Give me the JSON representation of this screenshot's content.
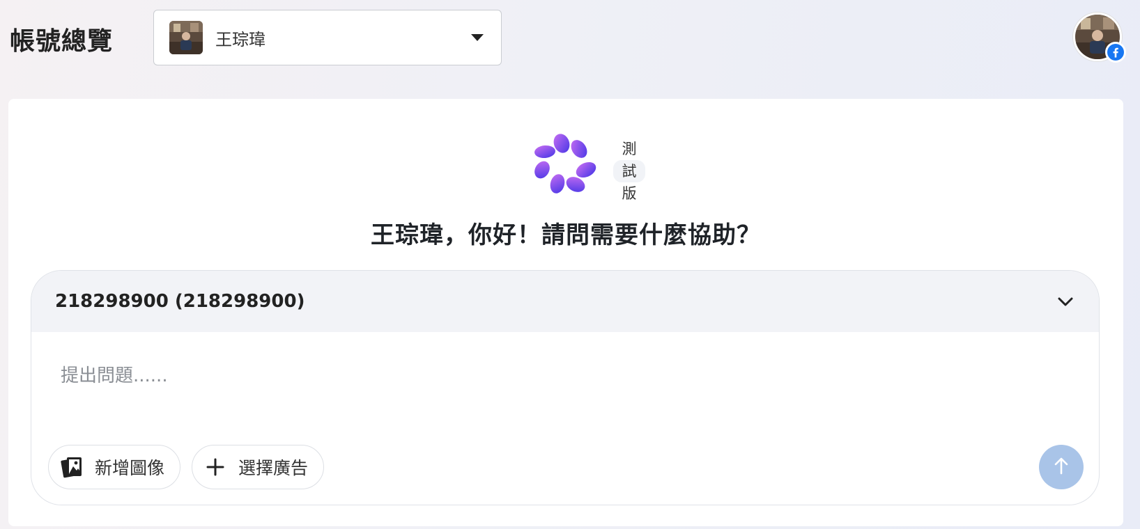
{
  "header": {
    "title": "帳號總覽",
    "account_selector": {
      "name": "王琮瑋",
      "caret_icon": "caret-down-icon"
    },
    "profile": {
      "avatar_icon": "user-avatar",
      "badge_icon": "facebook-icon",
      "badge_color": "#1877f2"
    }
  },
  "main": {
    "logo_icon": "petal-logo-icon",
    "beta_label": [
      "測",
      "試",
      "版"
    ],
    "greeting": "王琮瑋，你好！請問需要什麼協助？",
    "composer": {
      "ad_account": "218298900 (218298900)",
      "ad_account_toggle_icon": "chevron-down-icon",
      "placeholder": "提出問題......",
      "add_image_label": "新增圖像",
      "add_image_icon": "images-icon",
      "select_ad_label": "選擇廣告",
      "select_ad_icon": "plus-icon",
      "send_icon": "arrow-up-icon",
      "send_color": "#a9c4e8"
    }
  },
  "colors": {
    "logo_gradient": [
      "#c86ef2",
      "#5a3ee8"
    ]
  }
}
